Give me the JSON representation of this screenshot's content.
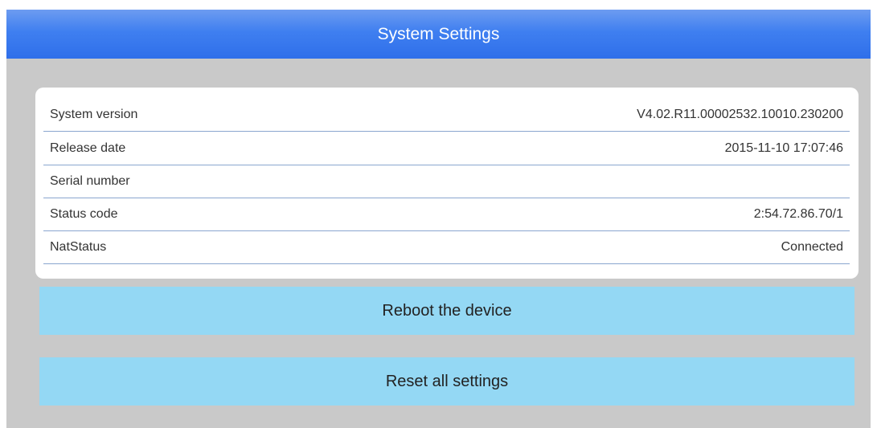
{
  "header": {
    "title": "System Settings"
  },
  "info": {
    "rows": [
      {
        "label": "System version",
        "value": "V4.02.R11.00002532.10010.230200"
      },
      {
        "label": "Release date",
        "value": "2015-11-10 17:07:46"
      },
      {
        "label": "Serial number",
        "value": ""
      },
      {
        "label": "Status code",
        "value": "2:54.72.86.70/1"
      },
      {
        "label": "NatStatus",
        "value": "Connected"
      }
    ]
  },
  "actions": {
    "reboot_label": "Reboot the device",
    "reset_label": "Reset all settings"
  },
  "colors": {
    "titlebar": "#3f7ff0",
    "background": "#c9c9c9",
    "button": "#94d8f4",
    "divider": "#8aa6cf"
  }
}
